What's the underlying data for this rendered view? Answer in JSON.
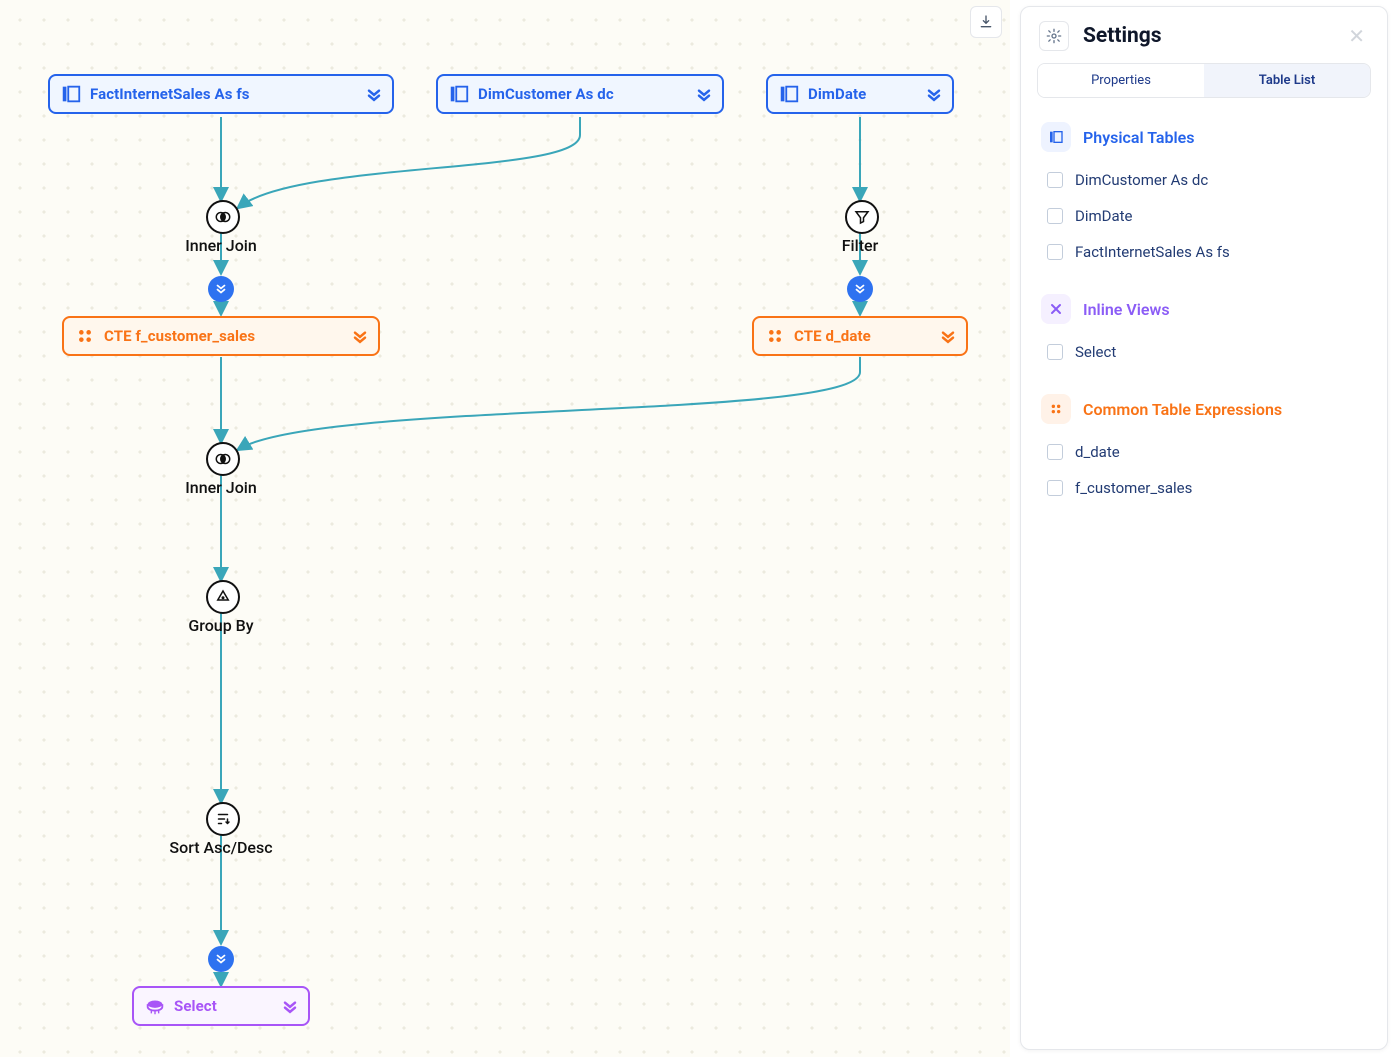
{
  "canvas": {
    "nodes": {
      "fact": {
        "label": "FactInternetSales As fs"
      },
      "dimc": {
        "label": "DimCustomer As dc"
      },
      "dimd": {
        "label": "DimDate"
      },
      "cte1": {
        "label": "CTE f_customer_sales"
      },
      "cte2": {
        "label": "CTE d_date"
      },
      "select": {
        "label": "Select"
      }
    },
    "ops": {
      "join1": {
        "label": "Inner Join"
      },
      "filter": {
        "label": "Filter"
      },
      "join2": {
        "label": "Inner Join"
      },
      "group": {
        "label": "Group By"
      },
      "sort": {
        "label": "Sort Asc/Desc"
      }
    }
  },
  "panel": {
    "title": "Settings",
    "tabs": {
      "a": "Properties",
      "b": "Table List"
    },
    "sections": {
      "physical": {
        "title": "Physical Tables",
        "items": [
          "DimCustomer As dc",
          "DimDate",
          "FactInternetSales As fs"
        ]
      },
      "inline": {
        "title": "Inline Views",
        "items": [
          "Select"
        ]
      },
      "cte": {
        "title": "Common Table Expressions",
        "items": [
          "d_date",
          "f_customer_sales"
        ]
      }
    }
  }
}
